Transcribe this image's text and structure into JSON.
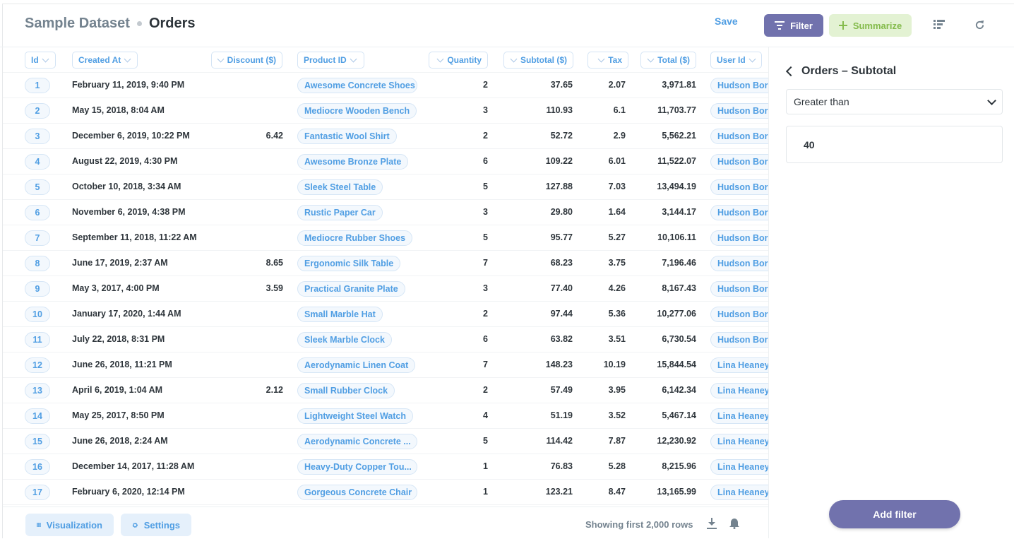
{
  "header": {
    "database": "Sample Dataset",
    "table": "Orders",
    "save_label": "Save",
    "filter_label": "Filter",
    "summarize_label": "Summarize"
  },
  "columns": [
    {
      "key": "id",
      "label": "Id"
    },
    {
      "key": "created_at",
      "label": "Created At"
    },
    {
      "key": "discount",
      "label": "Discount ($)"
    },
    {
      "key": "product_id",
      "label": "Product ID"
    },
    {
      "key": "quantity",
      "label": "Quantity"
    },
    {
      "key": "subtotal",
      "label": "Subtotal ($)"
    },
    {
      "key": "tax",
      "label": "Tax"
    },
    {
      "key": "total",
      "label": "Total ($)"
    },
    {
      "key": "user_id",
      "label": "User Id"
    }
  ],
  "rows": [
    {
      "id": "1",
      "created_at": "February 11, 2019, 9:40 PM",
      "discount": "",
      "product": "Awesome Concrete Shoes",
      "quantity": "2",
      "subtotal": "37.65",
      "tax": "2.07",
      "total": "3,971.81",
      "user": "Hudson Borer"
    },
    {
      "id": "2",
      "created_at": "May 15, 2018, 8:04 AM",
      "discount": "",
      "product": "Mediocre Wooden Bench",
      "quantity": "3",
      "subtotal": "110.93",
      "tax": "6.1",
      "total": "11,703.77",
      "user": "Hudson Borer"
    },
    {
      "id": "3",
      "created_at": "December 6, 2019, 10:22 PM",
      "discount": "6.42",
      "product": "Fantastic Wool Shirt",
      "quantity": "2",
      "subtotal": "52.72",
      "tax": "2.9",
      "total": "5,562.21",
      "user": "Hudson Borer"
    },
    {
      "id": "4",
      "created_at": "August 22, 2019, 4:30 PM",
      "discount": "",
      "product": "Awesome Bronze Plate",
      "quantity": "6",
      "subtotal": "109.22",
      "tax": "6.01",
      "total": "11,522.07",
      "user": "Hudson Borer"
    },
    {
      "id": "5",
      "created_at": "October 10, 2018, 3:34 AM",
      "discount": "",
      "product": "Sleek Steel Table",
      "quantity": "5",
      "subtotal": "127.88",
      "tax": "7.03",
      "total": "13,494.19",
      "user": "Hudson Borer"
    },
    {
      "id": "6",
      "created_at": "November 6, 2019, 4:38 PM",
      "discount": "",
      "product": "Rustic Paper Car",
      "quantity": "3",
      "subtotal": "29.80",
      "tax": "1.64",
      "total": "3,144.17",
      "user": "Hudson Borer"
    },
    {
      "id": "7",
      "created_at": "September 11, 2018, 11:22 AM",
      "discount": "",
      "product": "Mediocre Rubber Shoes",
      "quantity": "5",
      "subtotal": "95.77",
      "tax": "5.27",
      "total": "10,106.11",
      "user": "Hudson Borer"
    },
    {
      "id": "8",
      "created_at": "June 17, 2019, 2:37 AM",
      "discount": "8.65",
      "product": "Ergonomic Silk Table",
      "quantity": "7",
      "subtotal": "68.23",
      "tax": "3.75",
      "total": "7,196.46",
      "user": "Hudson Borer"
    },
    {
      "id": "9",
      "created_at": "May 3, 2017, 4:00 PM",
      "discount": "3.59",
      "product": "Practical Granite Plate",
      "quantity": "3",
      "subtotal": "77.40",
      "tax": "4.26",
      "total": "8,167.43",
      "user": "Hudson Borer"
    },
    {
      "id": "10",
      "created_at": "January 17, 2020, 1:44 AM",
      "discount": "",
      "product": "Small Marble Hat",
      "quantity": "2",
      "subtotal": "97.44",
      "tax": "5.36",
      "total": "10,277.06",
      "user": "Hudson Borer"
    },
    {
      "id": "11",
      "created_at": "July 22, 2018, 8:31 PM",
      "discount": "",
      "product": "Sleek Marble Clock",
      "quantity": "6",
      "subtotal": "63.82",
      "tax": "3.51",
      "total": "6,730.54",
      "user": "Hudson Borer"
    },
    {
      "id": "12",
      "created_at": "June 26, 2018, 11:21 PM",
      "discount": "",
      "product": "Aerodynamic Linen Coat",
      "quantity": "7",
      "subtotal": "148.23",
      "tax": "10.19",
      "total": "15,844.54",
      "user": "Lina Heaney"
    },
    {
      "id": "13",
      "created_at": "April 6, 2019, 1:04 AM",
      "discount": "2.12",
      "product": "Small Rubber Clock",
      "quantity": "2",
      "subtotal": "57.49",
      "tax": "3.95",
      "total": "6,142.34",
      "user": "Lina Heaney"
    },
    {
      "id": "14",
      "created_at": "May 25, 2017, 8:50 PM",
      "discount": "",
      "product": "Lightweight Steel Watch",
      "quantity": "4",
      "subtotal": "51.19",
      "tax": "3.52",
      "total": "5,467.14",
      "user": "Lina Heaney"
    },
    {
      "id": "15",
      "created_at": "June 26, 2018, 2:24 AM",
      "discount": "",
      "product": "Aerodynamic Concrete ...",
      "quantity": "5",
      "subtotal": "114.42",
      "tax": "7.87",
      "total": "12,230.92",
      "user": "Lina Heaney"
    },
    {
      "id": "16",
      "created_at": "December 14, 2017, 11:28 AM",
      "discount": "",
      "product": "Heavy-Duty Copper Tou...",
      "quantity": "1",
      "subtotal": "76.83",
      "tax": "5.28",
      "total": "8,215.96",
      "user": "Lina Heaney"
    },
    {
      "id": "17",
      "created_at": "February 6, 2020, 12:14 PM",
      "discount": "",
      "product": "Gorgeous Concrete Chair",
      "quantity": "1",
      "subtotal": "123.21",
      "tax": "8.47",
      "total": "13,165.99",
      "user": "Lina Heaney"
    }
  ],
  "footer": {
    "visualization_label": "Visualization",
    "settings_label": "Settings",
    "rows_text": "Showing first 2,000 rows"
  },
  "panel": {
    "title": "Orders – Subtotal",
    "operator": "Greater than",
    "value": "40",
    "add_filter_label": "Add filter"
  },
  "colors": {
    "brand": "#509ee3",
    "filter": "#7172ad",
    "summarize": "#84bb4c"
  }
}
